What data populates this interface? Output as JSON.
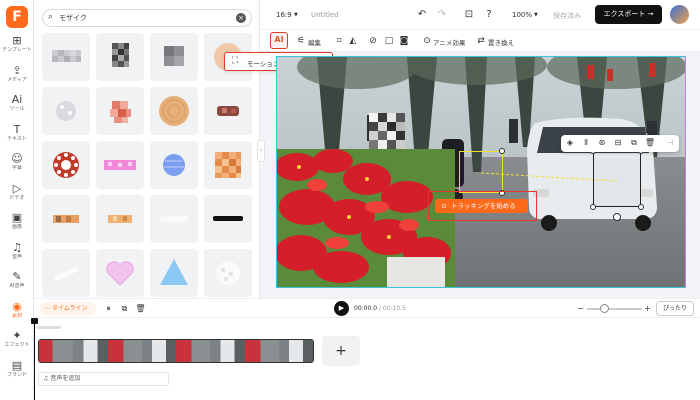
{
  "app": {
    "logo_letter": "F",
    "accent_color": "#ff6a1a",
    "highlight_color": "#e03a2c",
    "selection_color": "#3ac5d6"
  },
  "rail": {
    "items": [
      {
        "icon": "⊞",
        "label": "テンプレート"
      },
      {
        "icon": "⇪",
        "label": "メディア"
      },
      {
        "icon": "Ai",
        "label": "ツール"
      },
      {
        "icon": "T",
        "label": "テキスト"
      },
      {
        "icon": "☺",
        "label": "字幕"
      },
      {
        "icon": "▷",
        "label": "ビデオ"
      },
      {
        "icon": "▣",
        "label": "画像"
      },
      {
        "icon": "♫",
        "label": "音声"
      },
      {
        "icon": "✎",
        "label": "AI音声"
      },
      {
        "icon": "◉",
        "label": "素材"
      },
      {
        "icon": "✦",
        "label": "エフェクト"
      },
      {
        "icon": "▤",
        "label": "ブランド"
      }
    ],
    "active_index": 9
  },
  "panel": {
    "search_value": "モザイク",
    "search_icon": "search-icon",
    "clear_icon": "close-icon"
  },
  "header": {
    "aspect": "16:9",
    "title": "Untitled",
    "zoom": "100%",
    "save_label": "保存済み",
    "export_label": "エクスポート"
  },
  "toolbar": {
    "ai_label": "AI",
    "edit_label": "編集",
    "anim_label": "アニメ効果",
    "replace_label": "置き換え"
  },
  "menu": {
    "motion_tracking_label": "モーショントラッキング"
  },
  "canvas": {
    "start_tracking_label": "トラッキングを始める"
  },
  "playbar": {
    "timeline_label": "タイムライン",
    "current_time": "00:00.0",
    "separator": "/",
    "total_time": "00:10.5",
    "fit_label": "ぴったり"
  },
  "timeline": {
    "add_audio_label": "音声を追加"
  }
}
